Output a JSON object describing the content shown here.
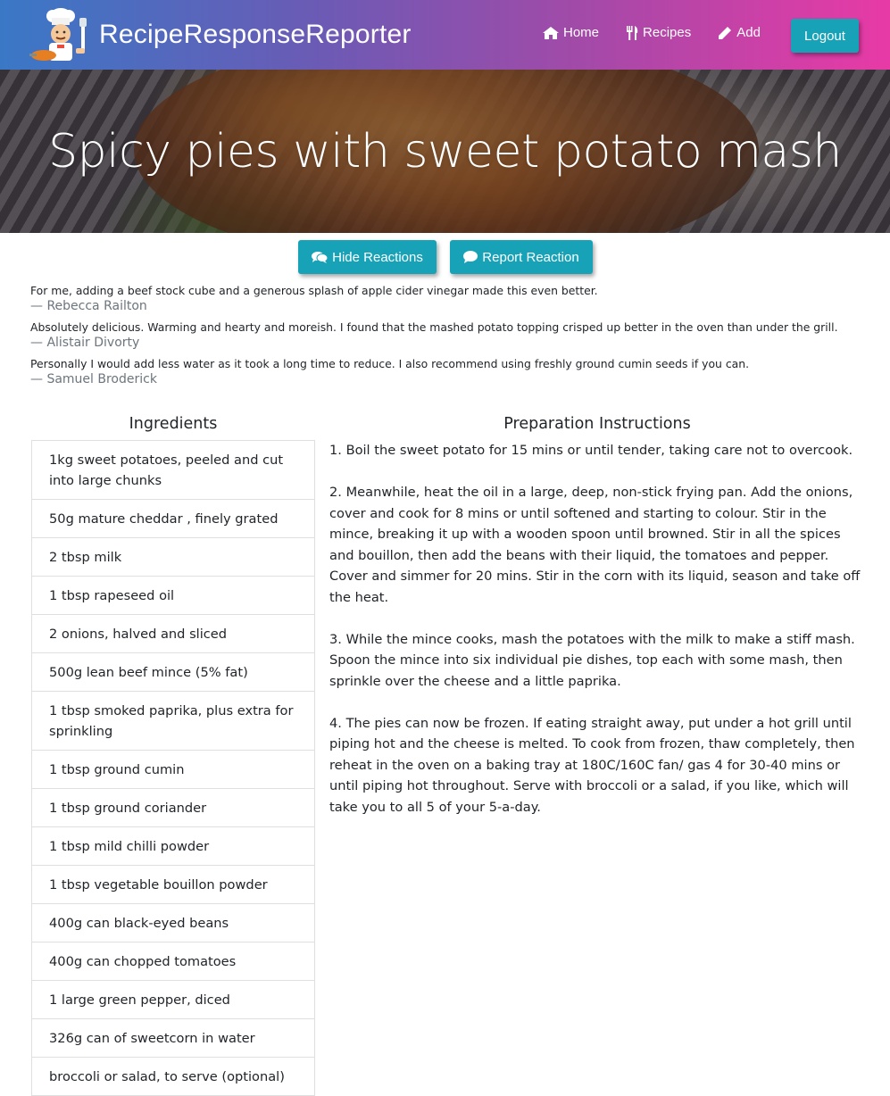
{
  "navbar": {
    "brand": "RecipeResponseReporter",
    "links": [
      {
        "icon": "home-icon",
        "label": "Home"
      },
      {
        "icon": "cutlery-icon",
        "label": "Recipes"
      },
      {
        "icon": "pencil-icon",
        "label": "Add"
      }
    ],
    "logout_label": "Logout"
  },
  "hero": {
    "title": "Spicy pies with sweet potato mash"
  },
  "actions": {
    "hide_reactions_label": "Hide Reactions",
    "report_reaction_label": "Report Reaction"
  },
  "reactions": [
    {
      "text": "For me, adding a beef stock cube and a generous splash of apple cider vinegar made this even better.",
      "author": "— Rebecca Railton"
    },
    {
      "text": "Absolutely delicious. Warming and hearty and moreish. I found that the mashed potato topping crisped up better in the oven than under the grill.",
      "author": "— Alistair Divorty"
    },
    {
      "text": "Personally I would add less water as it took a long time to reduce. I also recommend using freshly ground cumin seeds if you can.",
      "author": "— Samuel Broderick"
    }
  ],
  "ingredients": {
    "heading": "Ingredients",
    "items": [
      "1kg sweet potatoes, peeled and cut into large chunks",
      "50g mature cheddar , finely grated",
      "2 tbsp milk",
      "1 tbsp rapeseed oil",
      "2 onions, halved and sliced",
      "500g lean beef mince (5% fat)",
      "1 tbsp smoked paprika, plus extra for sprinkling",
      "1 tbsp ground cumin",
      "1 tbsp ground coriander",
      "1 tbsp mild chilli powder",
      "1 tbsp vegetable bouillon powder",
      "400g can black-eyed beans",
      "400g can chopped tomatoes",
      "1 large green pepper, diced",
      "326g can of sweetcorn in water",
      "broccoli or salad, to serve (optional)"
    ]
  },
  "instructions": {
    "heading": "Preparation Instructions",
    "steps": [
      "1. Boil the sweet potato for 15 mins or until tender, taking care not to overcook.",
      "2. Meanwhile, heat the oil in a large, deep, non-stick frying pan. Add the onions, cover and cook for 8 mins or until softened and starting to colour. Stir in the mince, breaking it up with a wooden spoon until browned. Stir in all the spices and bouillon, then add the beans with their liquid, the tomatoes and pepper. Cover and simmer for 20 mins. Stir in the corn with its liquid, season and take off the heat.",
      "3. While the mince cooks, mash the potatoes with the milk to make a stiff mash. Spoon the mince into six individual pie dishes, top each with some mash, then sprinkle over the cheese and a little paprika.",
      "4. The pies can now be frozen. If eating straight away, put under a hot grill until piping hot and the cheese is melted. To cook from frozen, thaw completely, then reheat in the oven on a baking tray at 180C/160C fan/ gas 4 for 30-40 mins or until piping hot throughout. Serve with broccoli or a salad, if you like, which will take you to all 5 of your 5-a-day."
    ]
  }
}
